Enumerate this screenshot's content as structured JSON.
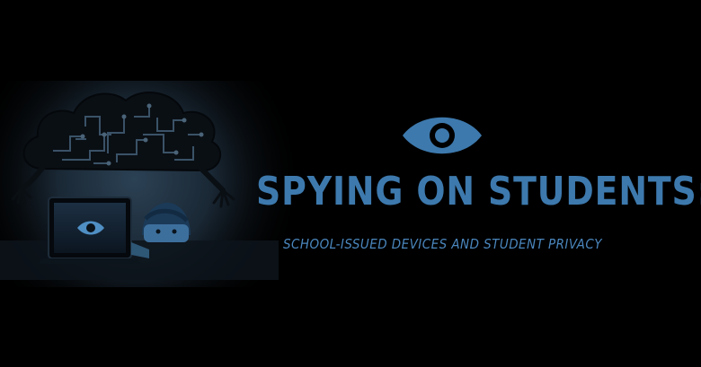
{
  "title": "SPYING ON STUDENTS:",
  "subtitle": "SCHOOL-ISSUED DEVICES AND STUDENT PRIVACY",
  "icons": {
    "logo": "eye-icon",
    "illustration": "cloud-monster-laptop-illustration"
  },
  "colors": {
    "background": "#000000",
    "accent": "#3d79ad",
    "accent_light": "#4a86bd",
    "glow": "#1f3345"
  }
}
